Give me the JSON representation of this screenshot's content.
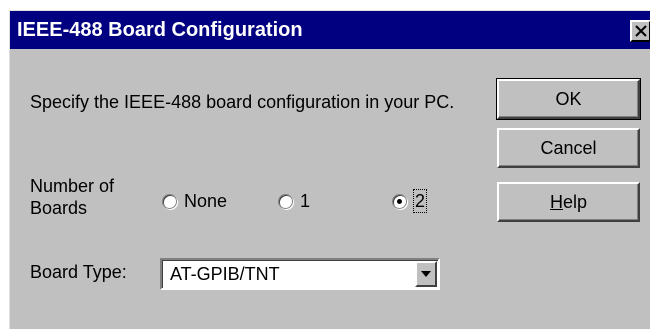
{
  "dialog": {
    "title": "IEEE-488 Board Configuration",
    "close_icon": "close-icon"
  },
  "description": "Specify the IEEE-488 board configuration in your PC.",
  "number_of_boards": {
    "label": "Number of Boards",
    "options": [
      {
        "label": "None",
        "checked": false
      },
      {
        "label": "1",
        "checked": false
      },
      {
        "label": "2",
        "checked": true
      }
    ]
  },
  "buttons": {
    "ok": "OK",
    "cancel": "Cancel",
    "help_mnemonic": "H",
    "help_rest": "elp"
  },
  "board_type": {
    "label": "Board Type:",
    "value": "AT-GPIB/TNT",
    "dropdown_icon": "chevron-down-icon"
  }
}
